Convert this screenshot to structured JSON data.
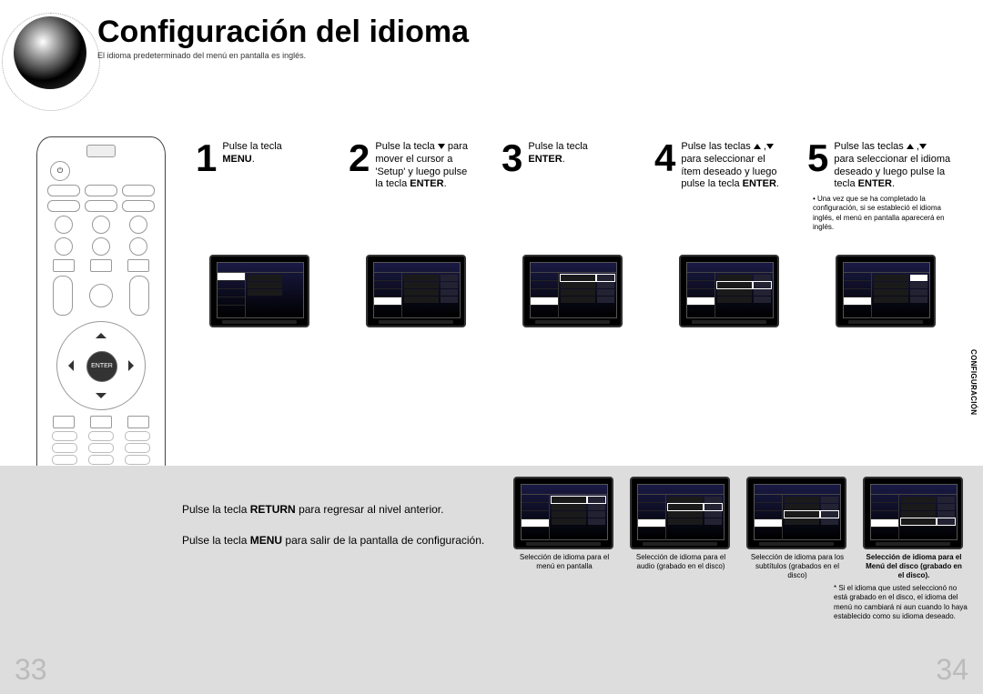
{
  "title": "Configuración del idioma",
  "subtitle": "El idioma predeterminado del menú en pantalla es inglés.",
  "remote": {
    "enter": "ENTER"
  },
  "steps": [
    {
      "num": "1",
      "line1": "Pulse la tecla",
      "bold": "MENU"
    },
    {
      "num": "2",
      "line1": "Pulse la tecla",
      "line1b": "para",
      "line2": "mover el cursor a",
      "line3": "'Setup' y luego pulse",
      "line4a": "la tecla",
      "bold": "ENTER"
    },
    {
      "num": "3",
      "line1": "Pulse la tecla",
      "bold": "ENTER"
    },
    {
      "num": "4",
      "line1": "Pulse las teclas",
      "line2": "para seleccionar el",
      "line3": "ítem deseado y luego",
      "line4a": "pulse la tecla",
      "bold": "ENTER"
    },
    {
      "num": "5",
      "line1": "Pulse las teclas",
      "line2": "para seleccionar el idioma",
      "line3": "deseado y luego pulse la",
      "line4a": "tecla",
      "bold": "ENTER",
      "note": "Una vez que se ha completado la configuración, si se estableció el idioma inglés, el menú en pantalla aparecerá en inglés."
    }
  ],
  "sideTab": "CONFIGURACIÓN",
  "tips": {
    "return": {
      "pre": "Pulse la tecla",
      "bold": "RETURN",
      "post": "para regresar al nivel anterior."
    },
    "menu": {
      "pre": "Pulse la tecla",
      "bold": "MENU",
      "post": "para salir de la pantalla de configuración."
    }
  },
  "lower": {
    "caps": [
      "Selección de idioma para el menú en pantalla",
      "Selección de idioma para el audio (grabado en el disco)",
      "Selección de idioma para los subtítulos (grabados en el disco)",
      "Selección de idioma para el Menú del disco (grabado en el disco)."
    ],
    "footnote": "Si el idioma que usted seleccionó no está grabado en el disco, el idioma del menú no cambiará ni aun cuando lo haya establecido como su idioma deseado."
  },
  "page": {
    "left": "33",
    "right": "34"
  }
}
